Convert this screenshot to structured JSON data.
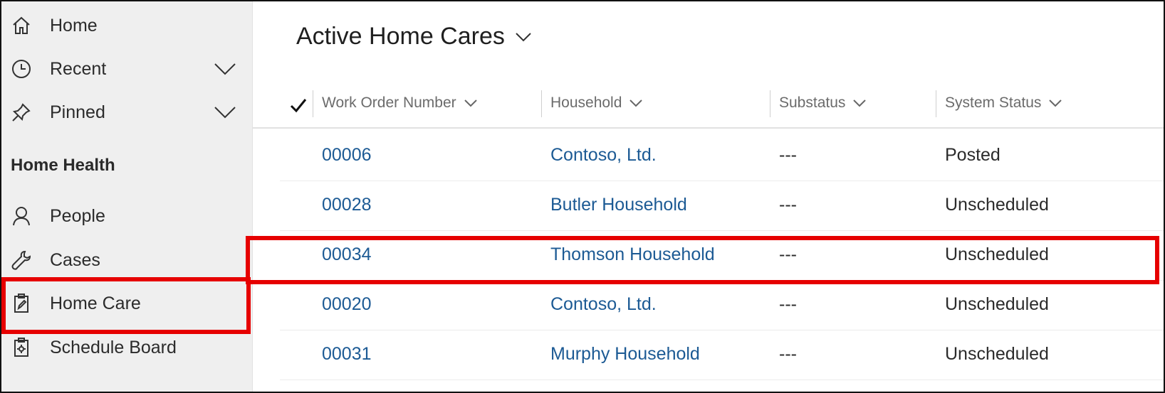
{
  "sidebar": {
    "items": [
      {
        "key": "home",
        "label": "Home",
        "icon": "home-icon",
        "expandable": false
      },
      {
        "key": "recent",
        "label": "Recent",
        "icon": "clock-icon",
        "expandable": true
      },
      {
        "key": "pinned",
        "label": "Pinned",
        "icon": "pin-icon",
        "expandable": true
      }
    ],
    "section_title": "Home Health",
    "section_items": [
      {
        "key": "people",
        "label": "People",
        "icon": "person-icon"
      },
      {
        "key": "cases",
        "label": "Cases",
        "icon": "wrench-icon"
      },
      {
        "key": "home-care",
        "label": "Home Care",
        "icon": "clipboard-edit-icon",
        "highlighted": true
      },
      {
        "key": "schedule-board",
        "label": "Schedule Board",
        "icon": "clipboard-gear-icon"
      }
    ]
  },
  "main": {
    "view_title": "Active Home Cares",
    "columns": [
      "Work Order Number",
      "Household",
      "Substatus",
      "System Status"
    ],
    "rows": [
      {
        "work_order": "00006",
        "household": "Contoso, Ltd.",
        "substatus": "---",
        "system_status": "Posted",
        "highlighted": false
      },
      {
        "work_order": "00028",
        "household": "Butler Household",
        "substatus": "---",
        "system_status": "Unscheduled",
        "highlighted": false
      },
      {
        "work_order": "00034",
        "household": "Thomson Household",
        "substatus": "---",
        "system_status": "Unscheduled",
        "highlighted": true
      },
      {
        "work_order": "00020",
        "household": "Contoso, Ltd.",
        "substatus": "---",
        "system_status": "Unscheduled",
        "highlighted": false
      },
      {
        "work_order": "00031",
        "household": "Murphy Household",
        "substatus": "---",
        "system_status": "Unscheduled",
        "highlighted": false
      }
    ]
  },
  "colors": {
    "highlight": "#e60000",
    "link": "#1c5a94",
    "sidebar_bg": "#efefef"
  }
}
